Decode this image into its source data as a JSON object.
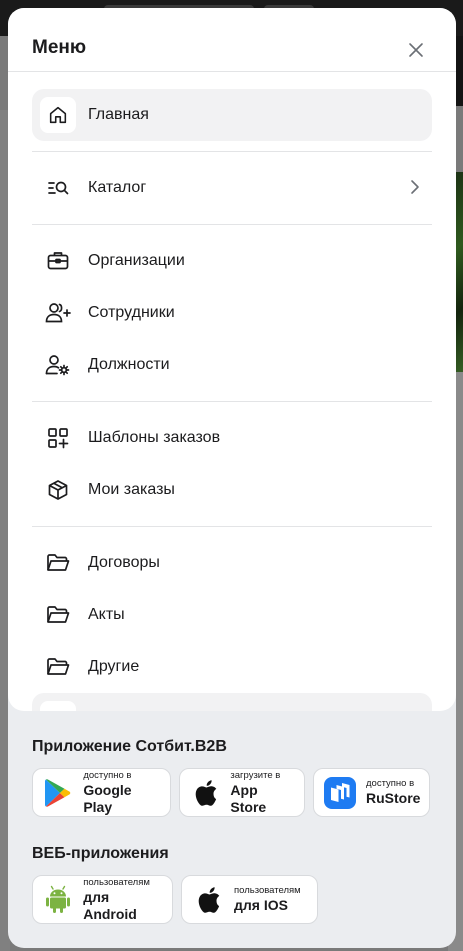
{
  "menu": {
    "title": "Меню",
    "items": [
      {
        "label": "Главная",
        "icon": "home-icon",
        "active": true
      },
      {
        "label": "Каталог",
        "icon": "catalog-search-icon",
        "has_chevron": true
      },
      {
        "label": "Организации",
        "icon": "briefcase-icon"
      },
      {
        "label": "Сотрудники",
        "icon": "user-plus-icon"
      },
      {
        "label": "Должности",
        "icon": "user-gear-icon"
      },
      {
        "label": "Шаблоны заказов",
        "icon": "grid-plus-icon"
      },
      {
        "label": "Мои заказы",
        "icon": "box-icon"
      },
      {
        "label": "Договоры",
        "icon": "folder-icon"
      },
      {
        "label": "Акты",
        "icon": "folder-icon"
      },
      {
        "label": "Другие",
        "icon": "folder-icon"
      }
    ]
  },
  "apps": {
    "title": "Приложение Сотбит.B2B",
    "badges": [
      {
        "small": "доступно в",
        "big": "Google Play",
        "icon": "google-play-icon"
      },
      {
        "small": "загрузите в",
        "big": "App Store",
        "icon": "apple-icon"
      },
      {
        "small": "доступно в",
        "big": "RuStore",
        "icon": "rustore-icon"
      }
    ]
  },
  "web_apps": {
    "title": "ВЕБ-приложения",
    "badges": [
      {
        "small": "пользователям",
        "big": "для Android",
        "icon": "android-icon"
      },
      {
        "small": "пользователям",
        "big": "для IOS",
        "icon": "apple-icon"
      }
    ]
  },
  "colors": {
    "accent_rustore": "#1e7bf2",
    "android_green": "#7cb342",
    "active_bg": "#f2f2f3"
  }
}
